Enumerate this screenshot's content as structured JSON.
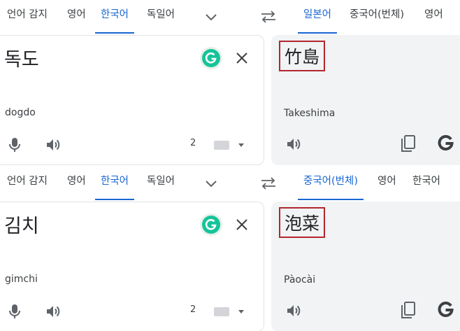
{
  "panels": [
    {
      "source_tabs": [
        "언어 감지",
        "영어",
        "한국어",
        "독일어"
      ],
      "target_tabs": [
        "일본어",
        "중국어(번체)",
        "영어"
      ],
      "source": {
        "text": "독도",
        "transliteration": "dogdo",
        "char_count": "2"
      },
      "target": {
        "text": "竹島",
        "transliteration": "Takeshima"
      }
    },
    {
      "source_tabs": [
        "언어 감지",
        "영어",
        "한국어",
        "독일어"
      ],
      "target_tabs": [
        "중국어(번체)",
        "영어",
        "한국어"
      ],
      "source": {
        "text": "김치",
        "transliteration": "gimchi",
        "char_count": "2"
      },
      "target": {
        "text": "泡菜",
        "transliteration": "Pàocài"
      }
    }
  ],
  "icons": {
    "expand": "chevron-down-icon",
    "swap": "swap-icon",
    "grammarly": "grammarly-icon",
    "clear": "close-icon",
    "mic": "microphone-icon",
    "speaker": "speaker-icon",
    "keyboard": "keyboard-icon",
    "copy": "copy-icon",
    "google": "google-logo-icon"
  },
  "colors": {
    "accent": "#1967d2",
    "highlight_box": "#b3262e",
    "target_bg": "#f1f3f4"
  }
}
